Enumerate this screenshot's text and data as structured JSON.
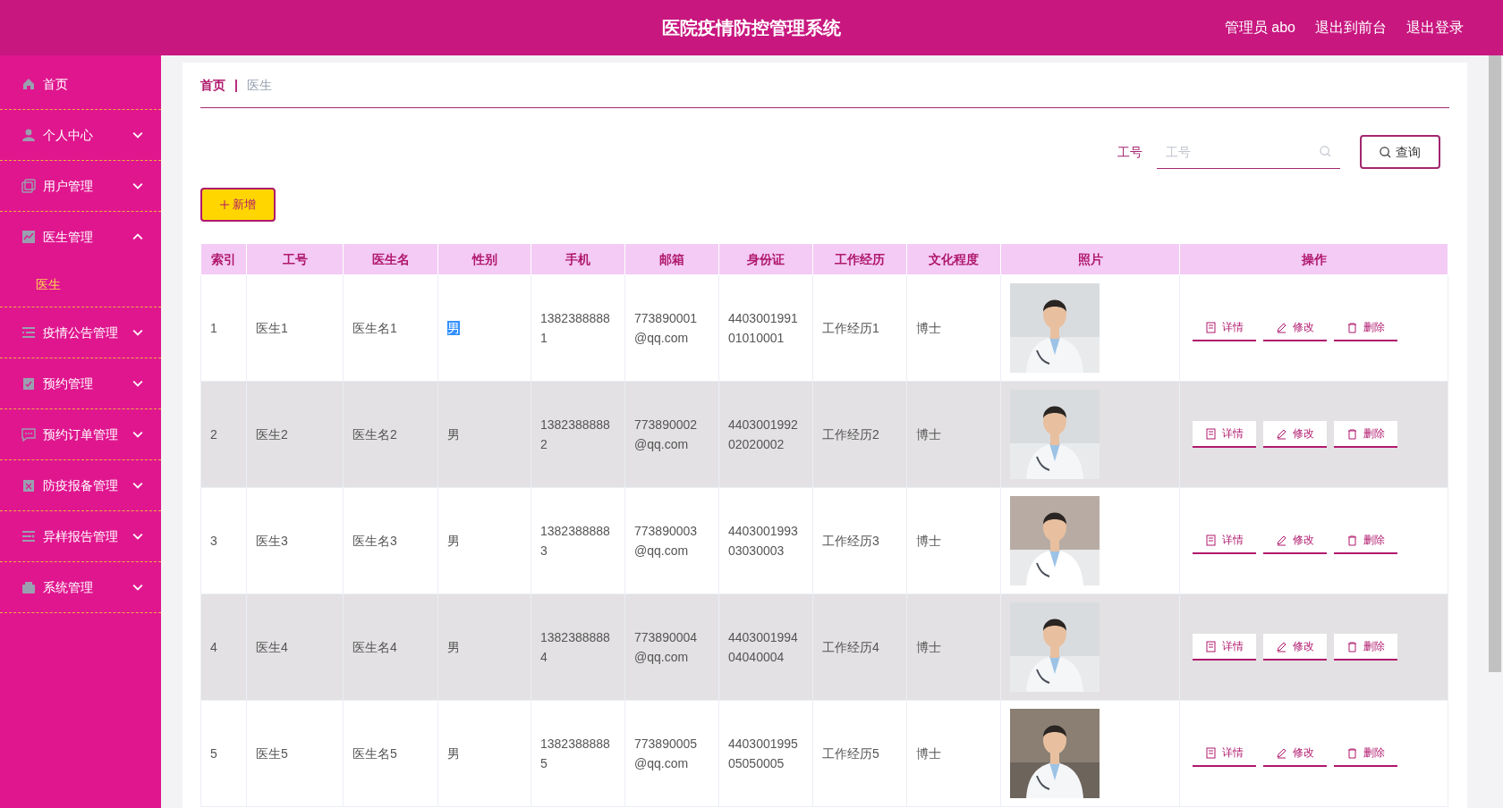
{
  "header": {
    "title": "医院疫情防控管理系统",
    "user": "管理员 abo",
    "links": [
      "退出到前台",
      "退出登录"
    ]
  },
  "sidebar": {
    "items": [
      {
        "label": "首页",
        "kind": "link"
      },
      {
        "label": "个人中心",
        "kind": "menu",
        "expanded": false
      },
      {
        "label": "用户管理",
        "kind": "menu",
        "expanded": false
      },
      {
        "label": "医生管理",
        "kind": "menu",
        "expanded": true,
        "children": [
          {
            "label": "医生",
            "selected": true
          }
        ]
      },
      {
        "label": "疫情公告管理",
        "kind": "menu",
        "expanded": false
      },
      {
        "label": "预约管理",
        "kind": "menu",
        "expanded": false
      },
      {
        "label": "预约订单管理",
        "kind": "menu",
        "expanded": false
      },
      {
        "label": "防疫报备管理",
        "kind": "menu",
        "expanded": false
      },
      {
        "label": "异样报告管理",
        "kind": "menu",
        "expanded": false
      },
      {
        "label": "系统管理",
        "kind": "menu",
        "expanded": false
      }
    ]
  },
  "breadcrumb": {
    "items": [
      "首页",
      "医生"
    ],
    "separator": "|"
  },
  "search": {
    "label": "工号",
    "placeholder": "工号",
    "button": "查询"
  },
  "add_button": "新增",
  "table": {
    "columns": [
      "索引",
      "工号",
      "医生名",
      "性别",
      "手机",
      "邮箱",
      "身份证",
      "工作经历",
      "文化程度",
      "照片",
      "操作"
    ],
    "rows": [
      {
        "index": "1",
        "id": "医生1",
        "name": "医生名1",
        "gender": "男",
        "gender_selected": true,
        "phone": "13823888881",
        "email": "773890001@qq.com",
        "id_card": "440300199101010001",
        "experience": "工作经历1",
        "education": "博士",
        "actions": [
          "详情",
          "修改",
          "删除"
        ]
      },
      {
        "index": "2",
        "id": "医生2",
        "name": "医生名2",
        "gender": "男",
        "gender_selected": false,
        "phone": "13823888882",
        "email": "773890002@qq.com",
        "id_card": "440300199202020002",
        "experience": "工作经历2",
        "education": "博士",
        "actions": [
          "详情",
          "修改",
          "删除"
        ]
      },
      {
        "index": "3",
        "id": "医生3",
        "name": "医生名3",
        "gender": "男",
        "gender_selected": false,
        "phone": "13823888883",
        "email": "773890003@qq.com",
        "id_card": "440300199303030003",
        "experience": "工作经历3",
        "education": "博士",
        "actions": [
          "详情",
          "修改",
          "删除"
        ]
      },
      {
        "index": "4",
        "id": "医生4",
        "name": "医生名4",
        "gender": "男",
        "gender_selected": false,
        "phone": "13823888884",
        "email": "773890004@qq.com",
        "id_card": "440300199404040004",
        "experience": "工作经历4",
        "education": "博士",
        "actions": [
          "详情",
          "修改",
          "删除"
        ]
      },
      {
        "index": "5",
        "id": "医生5",
        "name": "医生名5",
        "gender": "男",
        "gender_selected": false,
        "phone": "13823888885",
        "email": "773890005@qq.com",
        "id_card": "440300199505050005",
        "experience": "工作经历5",
        "education": "博士",
        "actions": [
          "详情",
          "修改",
          "删除"
        ]
      }
    ]
  }
}
